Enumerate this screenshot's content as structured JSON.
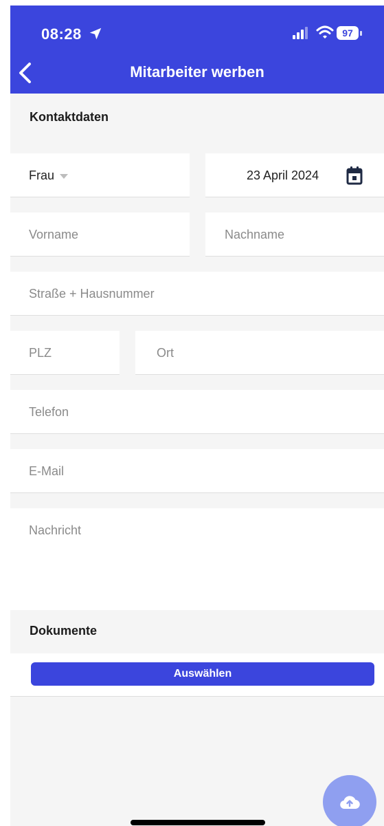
{
  "status_bar": {
    "time": "08:28",
    "battery": "97"
  },
  "nav": {
    "title": "Mitarbeiter werben"
  },
  "contact_section": {
    "title": "Kontaktdaten",
    "salutation_value": "Frau",
    "date_value": "23 April 2024",
    "firstname_placeholder": "Vorname",
    "lastname_placeholder": "Nachname",
    "street_placeholder": "Straße + Hausnummer",
    "zip_placeholder": "PLZ",
    "city_placeholder": "Ort",
    "phone_placeholder": "Telefon",
    "email_placeholder": "E-Mail",
    "message_placeholder": "Nachricht"
  },
  "documents_section": {
    "title": "Dokumente",
    "select_button": "Auswählen"
  },
  "colors": {
    "primary": "#3b45dd",
    "fab": "#8f9ff0",
    "background": "#f5f5f5"
  }
}
